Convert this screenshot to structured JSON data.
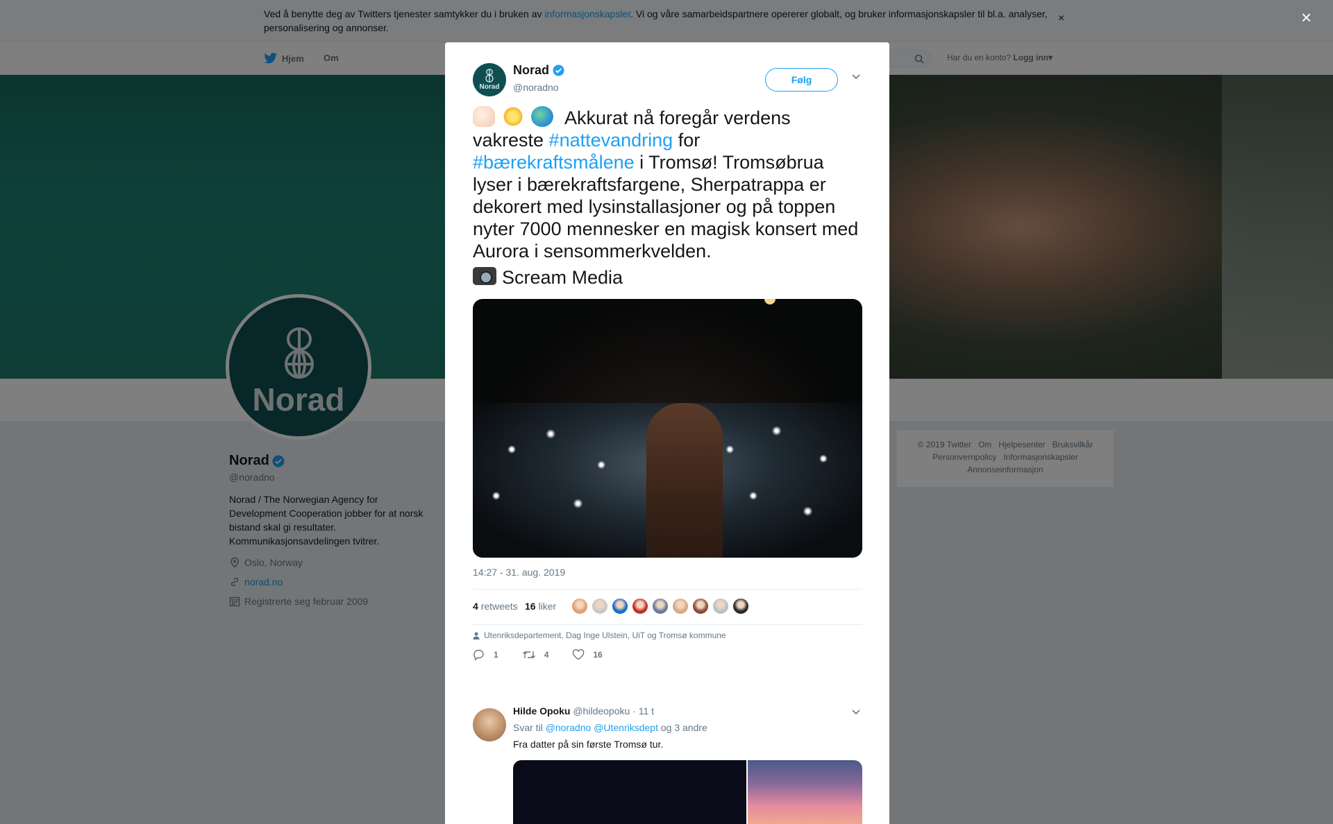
{
  "cookie_banner": {
    "text_before": "Ved å benytte deg av Twitters tjenester samtykker du i bruken av ",
    "link": "informasjonskapsler",
    "text_after": ". Vi og våre samarbeidspartnere opererer globalt, og bruker informasjonskapsler til bl.a. analyser, personalisering og annonser.",
    "close": "×"
  },
  "nav": {
    "home": "Hjem",
    "about": "Om",
    "account_prompt": "Har du en konto?",
    "login": "Logg inn"
  },
  "profile": {
    "name": "Norad",
    "handle": "@noradno",
    "logo_text": "Norad",
    "bio": "Norad / The Norwegian Agency for Development Cooperation jobber for at norsk bistand skal gi resultater. Kommunikasjonsavdelingen tvitrer.",
    "location": "Oslo, Norway",
    "url": "norad.no",
    "joined": "Registrerte seg februar 2009"
  },
  "footer": {
    "line1": [
      "© 2019 Twitter",
      "Om",
      "Hjelpesenter",
      "Bruksvilkår"
    ],
    "line2": [
      "Personvernpolicy",
      "Informasjonskapsler"
    ],
    "line3": [
      "Annonseinformasjon"
    ]
  },
  "modal_close": "×",
  "tweet": {
    "name": "Norad",
    "handle": "@noradno",
    "avatar_text": "Norad",
    "follow_label": "Følg",
    "text_part1": " Akkurat nå foregår verdens vakreste ",
    "hashtag1": "#nattevandring",
    "text_part2": " for ",
    "hashtag2": "#bærekraftsmålene",
    "text_part3": " i Tromsø! Tromsøbrua lyser i bærekraftsfargene, Sherpatrappa er dekorert med lysinstallasjoner og på toppen nyter 7000 mennesker en magisk konsert med Aurora i sensommerkvelden.",
    "credit": "Scream Media",
    "timestamp": "14:27 - 31. aug. 2019",
    "retweets_count": "4",
    "retweets_label": "retweets",
    "likes_count": "16",
    "likes_label": "liker",
    "liked_by": "Utenriksdepartement, Dag Inge Ulstein, UiT og Tromsø kommune",
    "replies": "1",
    "retweets": "4",
    "likes": "16",
    "liker_colors": [
      "#e0a070",
      "#c8c8c8",
      "#1b6fc4",
      "#c0302a",
      "#6a7a9a",
      "#d8a888",
      "#8a4a3a",
      "#b8c0c8",
      "#2a2a2a"
    ]
  },
  "reply": {
    "name": "Hilde Opoku",
    "handle": "@hildeopoku",
    "time": "· 11 t",
    "replying_to": "Svar til",
    "mention1": "@noradno",
    "mention2": "@Utenriksdept",
    "others": "og 3 andre",
    "text": "Fra datter på sin første Tromsø tur."
  }
}
